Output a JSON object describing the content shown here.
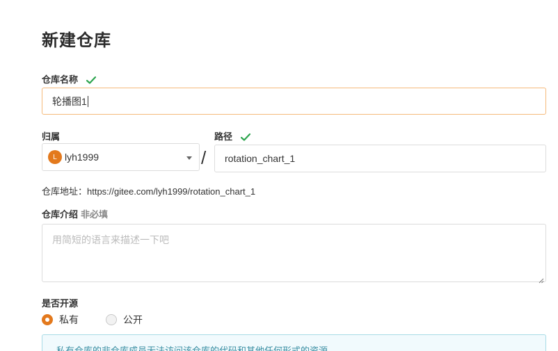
{
  "page": {
    "title": "新建仓库"
  },
  "repo_name": {
    "label": "仓库名称",
    "value": "轮播图1"
  },
  "owner": {
    "label": "归属",
    "avatar_letter": "L",
    "value": "lyh1999"
  },
  "path": {
    "label": "路径",
    "value": "rotation_chart_1",
    "separator": "/"
  },
  "address": {
    "text": "仓库地址：https://gitee.com/lyh1999/rotation_chart_1"
  },
  "description": {
    "label": "仓库介绍",
    "optional": "非必填",
    "placeholder": "用简短的语言来描述一下吧"
  },
  "open_source": {
    "label": "是否开源",
    "options": [
      {
        "label": "私有",
        "selected": true
      },
      {
        "label": "公开",
        "selected": false
      }
    ]
  },
  "notice": {
    "text": "私有仓库的非仓库成员无法访问该仓库的代码和其他任何形式的资源"
  },
  "colors": {
    "accent": "#e3791d",
    "success": "#2ca44e",
    "focus_border": "#f5b97a",
    "info_text": "#3b8fa3"
  },
  "icons": {
    "check": "check-icon",
    "dropdown": "chevron-down-icon"
  }
}
